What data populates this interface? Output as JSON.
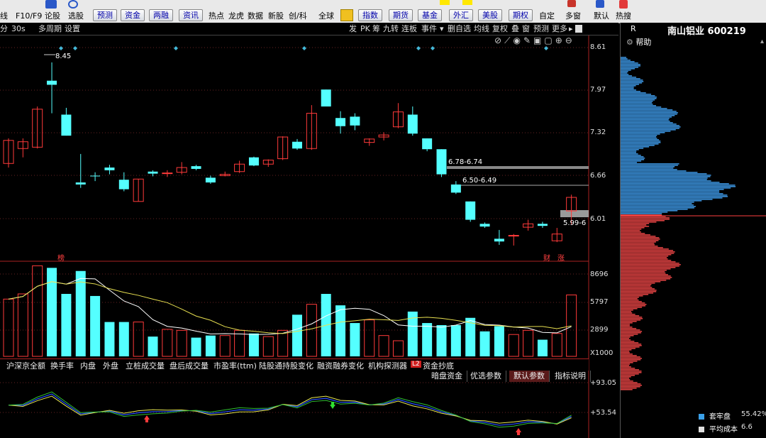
{
  "toolbar": {
    "left_items": [
      "线",
      "F10/F9",
      "论股",
      "选股"
    ],
    "buttons": [
      "预测",
      "资金",
      "两融",
      "资讯"
    ],
    "items": [
      "热点",
      "龙虎",
      "数据",
      "新股",
      "创/科",
      "全球"
    ],
    "buttons2": [
      "指数",
      "期货",
      "基金",
      "外汇",
      "美股",
      "期权"
    ],
    "right_items": [
      "自定",
      "多窗",
      "默认",
      "热搜"
    ]
  },
  "bar2": {
    "left": [
      "分",
      "30s",
      "多周期",
      "设置"
    ],
    "right": [
      "发",
      "PK",
      "筹",
      "九转",
      "连板",
      "事件",
      "删自选",
      "均线",
      "复权",
      "叠",
      "窗",
      "预测",
      "更多"
    ]
  },
  "panel": {
    "title": "南山铝业 600219",
    "r_label": "R",
    "help": "帮助",
    "legend": [
      {
        "label": "套牢盘",
        "value": "55.42%",
        "color": "#3aa0e8"
      },
      {
        "label": "平均成本",
        "value": "6.6",
        "color": "#e0e0e0"
      }
    ]
  },
  "price_axis": [
    "8.61",
    "7.97",
    "7.32",
    "6.66",
    "6.01"
  ],
  "volume_axis": [
    "8696",
    "5797",
    "2899",
    "X1000"
  ],
  "indicator_axis": [
    "+93.05",
    "+53.54"
  ],
  "annotations": {
    "high": "8.45",
    "level1": "6.78-6.74",
    "level2": "6.50-6.49",
    "level3": "5.99-6",
    "mark_left": "榜",
    "mark_right1": "财",
    "mark_right2": "涨"
  },
  "tabs": [
    "沪深京全额",
    "换手率",
    "内盘",
    "外盘",
    "立桩成交量",
    "盘后成交量",
    "市盈率(ttm)",
    "陆股通持股变化",
    "融资融券变化",
    "机构探测器",
    "资金抄底"
  ],
  "tab_badge": "L2",
  "subtabs": [
    "暗盘资金",
    "优选参数",
    "默认参数",
    "指标说明"
  ],
  "chart_data": {
    "type": "candlestick",
    "candles": [
      {
        "o": 6.96,
        "c": 7.3,
        "h": 7.33,
        "l": 6.9
      },
      {
        "o": 7.18,
        "c": 7.28,
        "h": 7.33,
        "l": 7.05
      },
      {
        "o": 7.2,
        "c": 7.76,
        "h": 7.8,
        "l": 7.18
      },
      {
        "o": 8.18,
        "c": 8.12,
        "h": 8.45,
        "l": 7.7
      },
      {
        "o": 7.68,
        "c": 7.37,
        "h": 7.78,
        "l": 7.37
      },
      {
        "o": 6.68,
        "c": 6.65,
        "h": 7.1,
        "l": 6.6
      },
      {
        "o": 6.78,
        "c": 6.77,
        "h": 6.83,
        "l": 6.7
      },
      {
        "o": 6.9,
        "c": 6.86,
        "h": 6.94,
        "l": 6.8
      },
      {
        "o": 6.72,
        "c": 6.58,
        "h": 6.83,
        "l": 6.55
      },
      {
        "o": 6.4,
        "c": 6.73,
        "h": 6.73,
        "l": 6.4
      },
      {
        "o": 6.84,
        "c": 6.81,
        "h": 6.86,
        "l": 6.77
      },
      {
        "o": 6.81,
        "c": 6.82,
        "h": 6.86,
        "l": 6.76
      },
      {
        "o": 6.83,
        "c": 6.9,
        "h": 6.98,
        "l": 6.8
      },
      {
        "o": 6.92,
        "c": 6.88,
        "h": 6.94,
        "l": 6.86
      },
      {
        "o": 6.75,
        "c": 6.68,
        "h": 6.78,
        "l": 6.66
      },
      {
        "o": 6.78,
        "c": 6.8,
        "h": 6.84,
        "l": 6.77
      },
      {
        "o": 6.84,
        "c": 6.95,
        "h": 7.0,
        "l": 6.82
      },
      {
        "o": 7.05,
        "c": 6.93,
        "h": 7.06,
        "l": 6.92
      },
      {
        "o": 6.95,
        "c": 7.01,
        "h": 7.02,
        "l": 6.91
      },
      {
        "o": 7.03,
        "c": 7.35,
        "h": 7.36,
        "l": 7.01
      },
      {
        "o": 7.28,
        "c": 7.18,
        "h": 7.32,
        "l": 7.16
      },
      {
        "o": 7.18,
        "c": 7.7,
        "h": 7.82,
        "l": 7.16
      },
      {
        "o": 8.05,
        "c": 7.8,
        "h": 8.05,
        "l": 7.8
      },
      {
        "o": 7.63,
        "c": 7.51,
        "h": 7.73,
        "l": 7.4
      },
      {
        "o": 7.65,
        "c": 7.52,
        "h": 7.7,
        "l": 7.45
      },
      {
        "o": 7.27,
        "c": 7.32,
        "h": 7.33,
        "l": 7.22
      },
      {
        "o": 7.35,
        "c": 7.38,
        "h": 7.42,
        "l": 7.3
      },
      {
        "o": 7.5,
        "c": 7.72,
        "h": 7.85,
        "l": 7.48
      },
      {
        "o": 7.68,
        "c": 7.4,
        "h": 7.8,
        "l": 7.37
      },
      {
        "o": 7.33,
        "c": 7.17,
        "h": 7.33,
        "l": 7.14
      },
      {
        "o": 7.17,
        "c": 6.8,
        "h": 7.17,
        "l": 6.76
      },
      {
        "o": 6.65,
        "c": 6.53,
        "h": 6.7,
        "l": 6.51
      },
      {
        "o": 6.4,
        "c": 6.13,
        "h": 6.4,
        "l": 6.1
      },
      {
        "o": 6.07,
        "c": 6.03,
        "h": 6.09,
        "l": 6.01
      },
      {
        "o": 5.85,
        "c": 5.81,
        "h": 5.98,
        "l": 5.76
      },
      {
        "o": 5.9,
        "c": 5.9,
        "h": 5.92,
        "l": 5.75
      },
      {
        "o": 6.02,
        "c": 6.07,
        "h": 6.13,
        "l": 5.97
      },
      {
        "o": 6.07,
        "c": 6.04,
        "h": 6.1,
        "l": 6.01
      },
      {
        "o": 5.82,
        "c": 5.92,
        "h": 6.01,
        "l": 5.8
      },
      {
        "o": 6.26,
        "c": 6.46,
        "h": 6.5,
        "l": 6.06
      }
    ],
    "volumes": [
      5.5,
      6.0,
      8.7,
      8.5,
      6.0,
      8.2,
      5.8,
      3.3,
      3.3,
      3.3,
      1.9,
      2.6,
      2.5,
      1.8,
      2.0,
      2.0,
      2.5,
      2.2,
      1.9,
      2.5,
      4.0,
      5.0,
      6.0,
      4.9,
      3.2,
      3.5,
      2.0,
      1.5,
      4.3,
      3.2,
      3.0,
      3.0,
      3.7,
      2.4,
      2.9,
      2.1,
      2.5,
      1.6,
      2.2,
      5.9
    ],
    "ylim": [
      5.55,
      8.7
    ],
    "vol_ylim": [
      0,
      9.0
    ]
  }
}
